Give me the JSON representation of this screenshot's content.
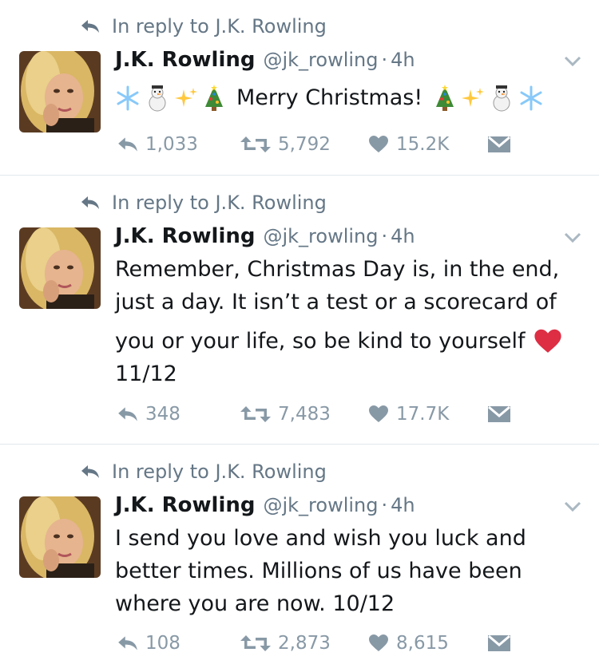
{
  "tweets": [
    {
      "reply_context": "In reply to J.K. Rowling",
      "name": "J.K. Rowling",
      "handle": "@jk_rowling",
      "dot": "·",
      "time": "4h",
      "text": "Merry Christmas!",
      "replies": "1,033",
      "retweets": "5,792",
      "likes": "15.2K"
    },
    {
      "reply_context": "In reply to J.K. Rowling",
      "name": "J.K. Rowling",
      "handle": "@jk_rowling",
      "dot": "·",
      "time": "4h",
      "lines": [
        "Remember, Christmas Day is, in the end,",
        "just a day. It isn’t a test or a scorecard of",
        "you or your life, so be kind to yourself",
        "11/12"
      ],
      "replies": "348",
      "retweets": "7,483",
      "likes": "17.7K"
    },
    {
      "reply_context": "In reply to J.K. Rowling",
      "name": "J.K. Rowling",
      "handle": "@jk_rowling",
      "dot": "·",
      "time": "4h",
      "lines": [
        "I send you love and wish you luck and",
        "better times. Millions of us have been",
        "where you are now. 10/12"
      ],
      "replies": "108",
      "retweets": "2,873",
      "likes": "8,615"
    }
  ]
}
